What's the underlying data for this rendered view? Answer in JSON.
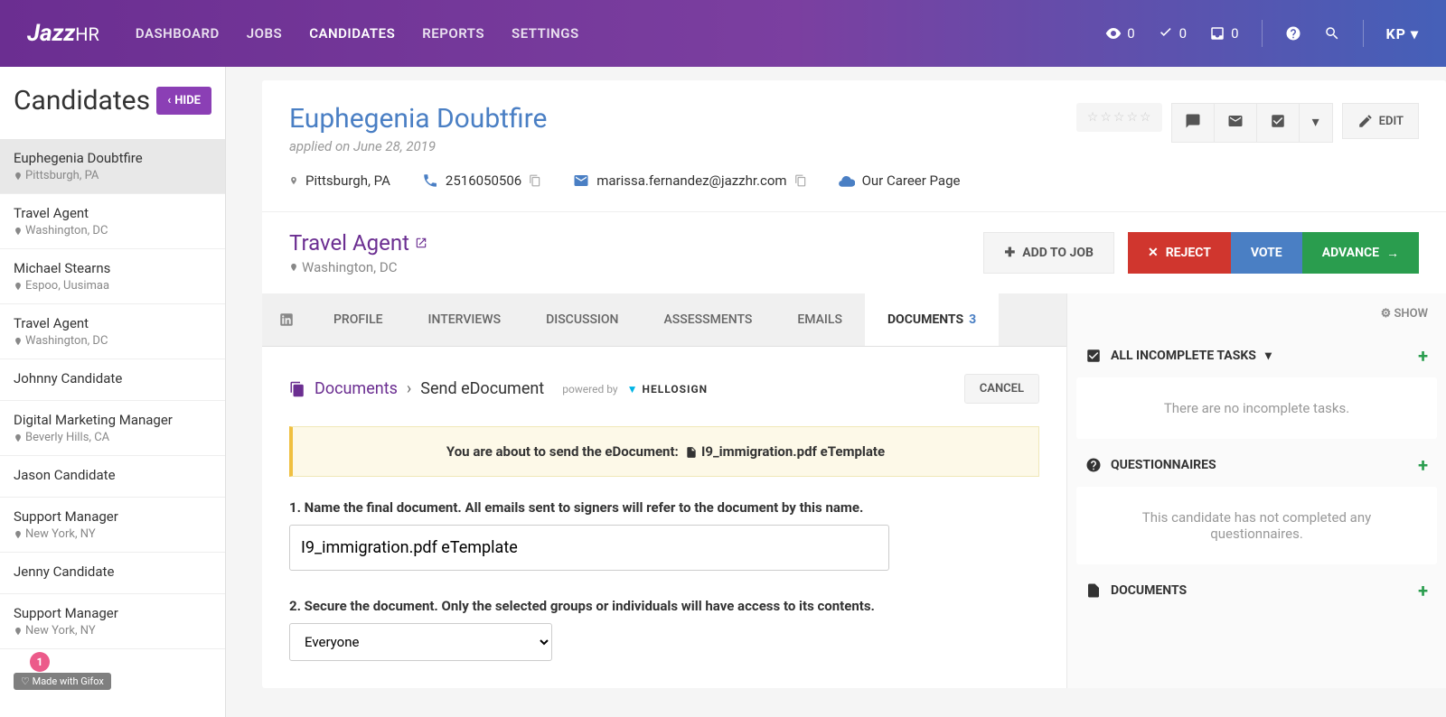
{
  "header": {
    "logo": "Jazz",
    "logoSuffix": "HR",
    "nav": [
      "DASHBOARD",
      "JOBS",
      "CANDIDATES",
      "REPORTS",
      "SETTINGS"
    ],
    "activeNav": 2,
    "views": "0",
    "checks": "0",
    "inbox": "0",
    "user": "KP"
  },
  "sidebar": {
    "title": "Candidates",
    "hideLabel": "HIDE",
    "items": [
      {
        "name": "Euphegenia Doubtfire",
        "loc": "Pittsburgh, PA"
      },
      {
        "name": "Travel Agent",
        "loc": "Washington, DC"
      },
      {
        "name": "Michael Stearns",
        "loc": "Espoo, Uusimaa"
      },
      {
        "name": "Travel Agent",
        "loc": "Washington, DC"
      },
      {
        "name": "Johnny Candidate",
        "loc": ""
      },
      {
        "name": "Digital Marketing Manager",
        "loc": "Beverly Hills, CA"
      },
      {
        "name": "Jason Candidate",
        "loc": ""
      },
      {
        "name": "Support Manager",
        "loc": "New York, NY"
      },
      {
        "name": "Jenny Candidate",
        "loc": ""
      },
      {
        "name": "Support Manager",
        "loc": "New York, NY"
      }
    ]
  },
  "profile": {
    "name": "Euphegenia Doubtfire",
    "applied": "applied on June 28, 2019",
    "location": "Pittsburgh, PA",
    "phone": "2516050506",
    "email": "marissa.fernandez@jazzhr.com",
    "source": "Our Career Page",
    "editLabel": "EDIT"
  },
  "job": {
    "title": "Travel Agent",
    "location": "Washington, DC",
    "addToJob": "ADD TO JOB",
    "reject": "REJECT",
    "vote": "VOTE",
    "advance": "ADVANCE"
  },
  "tabs": {
    "items": [
      "PROFILE",
      "INTERVIEWS",
      "DISCUSSION",
      "ASSESSMENTS",
      "EMAILS",
      "DOCUMENTS"
    ],
    "docCount": "3",
    "active": 5
  },
  "doc": {
    "breadcrumbRoot": "Documents",
    "breadcrumbCurrent": "Send eDocument",
    "poweredBy": "powered by",
    "hellosign": "HELLOSIGN",
    "cancel": "CANCEL",
    "alertPrefix": "You are about to send the eDocument:",
    "alertFile": "I9_immigration.pdf eTemplate",
    "step1Label": "1. Name the final document. All emails sent to signers will refer to the document by this name.",
    "step1Value": "I9_immigration.pdf eTemplate",
    "step2Label": "2. Secure the document. Only the selected groups or individuals will have access to its contents.",
    "step2Value": "Everyone"
  },
  "panel": {
    "show": "SHOW",
    "tasks": {
      "title": "ALL INCOMPLETE TASKS",
      "body": "There are no incomplete tasks."
    },
    "quest": {
      "title": "QUESTIONNAIRES",
      "body": "This candidate has not completed any questionnaires."
    },
    "docs": {
      "title": "DOCUMENTS"
    }
  },
  "gifox": {
    "count": "1",
    "text": "♡ Made with Gifox"
  }
}
